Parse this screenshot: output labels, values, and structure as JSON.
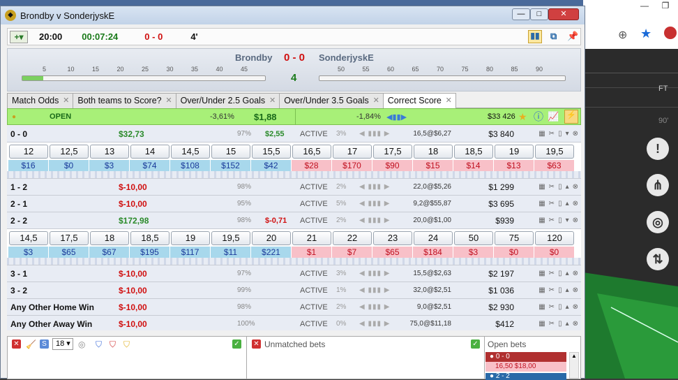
{
  "window": {
    "title": "Brondby v SonderjyskE"
  },
  "toolbar": {
    "kickoff": "20:00",
    "clock": "00:07:24",
    "score": "0 - 0",
    "minute": "4'"
  },
  "scoreboard": {
    "home": "Brondby",
    "away": "SonderjyskE",
    "score": "0 - 0",
    "minute_display": "4",
    "first_half_ticks": [
      "5",
      "10",
      "15",
      "20",
      "25",
      "30",
      "35",
      "40",
      "45"
    ],
    "second_half_ticks": [
      "50",
      "55",
      "60",
      "65",
      "70",
      "75",
      "80",
      "85",
      "90"
    ]
  },
  "tabs": [
    {
      "label": "Match Odds"
    },
    {
      "label": "Both teams to Score?"
    },
    {
      "label": "Over/Under 2.5 Goals"
    },
    {
      "label": "Over/Under 3.5 Goals"
    },
    {
      "label": "Correct Score"
    }
  ],
  "status": {
    "state": "OPEN",
    "back_pct": "-3,61%",
    "back_amount": "$1,88",
    "lay_pct": "-1,84%",
    "matched": "$33 426"
  },
  "rows": [
    {
      "name": "0 - 0",
      "pl": "$32,73",
      "pct": "97%",
      "pl2": "$2,55",
      "state": "ACTIVE",
      "pct2": "3%",
      "last": "16,5@$6,27",
      "vol": "$3 840",
      "neg": false,
      "neg2": false
    },
    {
      "name": "1 - 2",
      "pl": "$-10,00",
      "pct": "98%",
      "pl2": "",
      "state": "ACTIVE",
      "pct2": "2%",
      "last": "22,0@$5,26",
      "vol": "$1 299",
      "neg": true,
      "neg2": false
    },
    {
      "name": "2 - 1",
      "pl": "$-10,00",
      "pct": "95%",
      "pl2": "",
      "state": "ACTIVE",
      "pct2": "5%",
      "last": "9,2@$55,87",
      "vol": "$3 695",
      "neg": true,
      "neg2": false
    },
    {
      "name": "2 - 2",
      "pl": "$172,98",
      "pct": "98%",
      "pl2": "$-0,71",
      "state": "ACTIVE",
      "pct2": "2%",
      "last": "20,0@$1,00",
      "vol": "$939",
      "neg": false,
      "neg2": true
    },
    {
      "name": "3 - 1",
      "pl": "$-10,00",
      "pct": "97%",
      "pl2": "",
      "state": "ACTIVE",
      "pct2": "3%",
      "last": "15,5@$2,63",
      "vol": "$2 197",
      "neg": true,
      "neg2": false
    },
    {
      "name": "3 - 2",
      "pl": "$-10,00",
      "pct": "99%",
      "pl2": "",
      "state": "ACTIVE",
      "pct2": "1%",
      "last": "32,0@$2,51",
      "vol": "$1 036",
      "neg": true,
      "neg2": false
    },
    {
      "name": "Any Other Home Win",
      "pl": "$-10,00",
      "pct": "98%",
      "pl2": "",
      "state": "ACTIVE",
      "pct2": "2%",
      "last": "9,0@$2,51",
      "vol": "$2 930",
      "neg": true,
      "neg2": false
    },
    {
      "name": "Any Other Away Win",
      "pl": "$-10,00",
      "pct": "100%",
      "pl2": "",
      "state": "ACTIVE",
      "pct2": "0%",
      "last": "75,0@$11,18",
      "vol": "$412",
      "neg": true,
      "neg2": false
    }
  ],
  "ladders": {
    "0-0": {
      "odds": [
        "12",
        "12,5",
        "13",
        "14",
        "14,5",
        "15",
        "15,5",
        "16,5",
        "17",
        "17,5",
        "18",
        "18,5",
        "19",
        "19,5"
      ],
      "amounts": [
        "$16",
        "$0",
        "$3",
        "$74",
        "$108",
        "$152",
        "$42",
        "$28",
        "$170",
        "$90",
        "$15",
        "$14",
        "$13",
        "$63"
      ]
    },
    "2-2": {
      "odds": [
        "14,5",
        "17,5",
        "18",
        "18,5",
        "19",
        "19,5",
        "20",
        "21",
        "22",
        "23",
        "24",
        "50",
        "75",
        "120"
      ],
      "amounts": [
        "$3",
        "$65",
        "$67",
        "$195",
        "$117",
        "$11",
        "$221",
        "$1",
        "$7",
        "$65",
        "$184",
        "$3",
        "$0",
        "$0"
      ]
    }
  },
  "bottom": {
    "stake": "18",
    "unmatched_label": "Unmatched bets",
    "open_label": "Open bets",
    "open_bets": [
      {
        "name": "0 - 0",
        "detail": "16,50   $18,00"
      },
      {
        "name": "2 - 2"
      }
    ]
  },
  "desktop": {
    "ft_label": "FT",
    "min_label": "90'"
  }
}
